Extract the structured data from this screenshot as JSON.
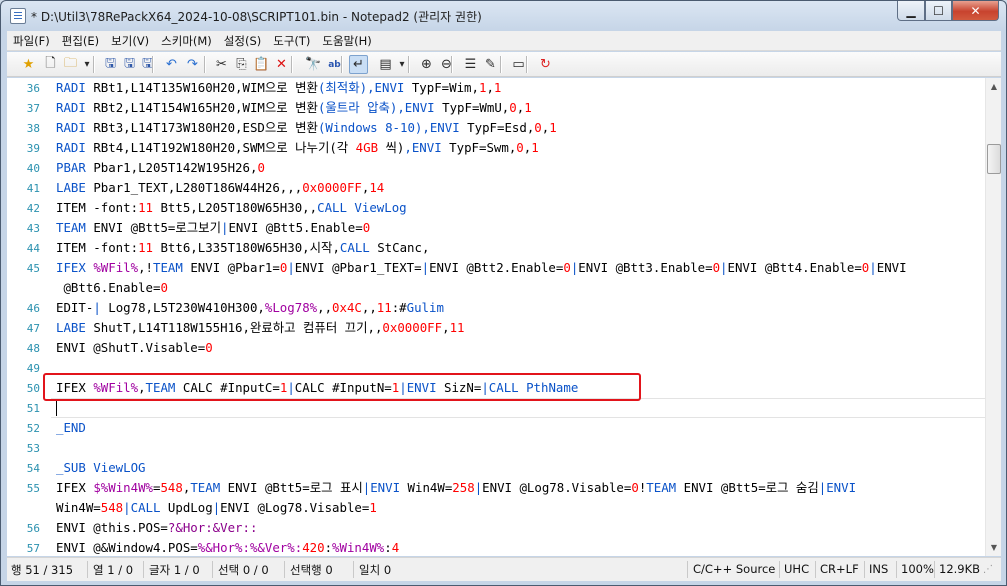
{
  "window": {
    "title": "* D:\\Util3\\78RePackX64_2024-10-08\\SCRIPT101.bin - Notepad2 (관리자 권한)",
    "controls": {
      "minimize": "▁",
      "maximize": "☐",
      "close": "✕"
    }
  },
  "menu": [
    "파일(F)",
    "편집(E)",
    "보기(V)",
    "스키마(M)",
    "설정(S)",
    "도구(T)",
    "도움말(H)"
  ],
  "toolbar": {
    "icons": [
      "star-icon",
      "new-file-icon",
      "open-folder-icon",
      "dropdown-icon",
      "save-icon",
      "save-as-icon",
      "save-copy-icon",
      "undo-icon",
      "redo-icon",
      "cut-icon",
      "copy-icon",
      "paste-icon",
      "delete-icon",
      "find-icon",
      "replace-icon",
      "word-wrap-icon",
      "scheme-icon",
      "dropdown-icon",
      "zoom-in-icon",
      "zoom-out-icon",
      "view-list-icon",
      "edit-icon",
      "terminal-icon",
      "exit-icon"
    ],
    "glyphs": [
      "★",
      "🗋",
      "🗀",
      "▾",
      "🖫",
      "🖫",
      "🖫",
      "↶",
      "↷",
      "✂",
      "⎘",
      "📋",
      "✕",
      "🔭",
      "ab",
      "↵",
      "▤",
      "▾",
      "⊕",
      "⊖",
      "☰",
      "✎",
      "▭",
      "↻"
    ]
  },
  "editor": {
    "lines": [
      {
        "num": "36",
        "tokens": [
          [
            "k",
            "RADI "
          ],
          [
            "d",
            "RBt1,L14T135W160H20,WIM으로 변환"
          ],
          [
            "k",
            "(최적화)"
          ],
          [
            "k",
            ",ENVI "
          ],
          [
            "d",
            "TypF=Wim,"
          ],
          [
            "n",
            "1"
          ],
          [
            "d",
            ","
          ],
          [
            "n",
            "1"
          ]
        ]
      },
      {
        "num": "37",
        "tokens": [
          [
            "k",
            "RADI "
          ],
          [
            "d",
            "RBt2,L14T154W165H20,WIM으로 변환"
          ],
          [
            "k",
            "(울트라 압축)"
          ],
          [
            "k",
            ",ENVI "
          ],
          [
            "d",
            "TypF=WmU,"
          ],
          [
            "n",
            "0"
          ],
          [
            "d",
            ","
          ],
          [
            "n",
            "1"
          ]
        ]
      },
      {
        "num": "38",
        "tokens": [
          [
            "k",
            "RADI "
          ],
          [
            "d",
            "RBt3,L14T173W180H20,ESD으로 변환"
          ],
          [
            "k",
            "(Windows 8-10)"
          ],
          [
            "k",
            ",ENVI "
          ],
          [
            "d",
            "TypF=Esd,"
          ],
          [
            "n",
            "0"
          ],
          [
            "d",
            ","
          ],
          [
            "n",
            "1"
          ]
        ]
      },
      {
        "num": "39",
        "tokens": [
          [
            "k",
            "RADI "
          ],
          [
            "d",
            "RBt4,L14T192W180H20,SWM으로 나누기(각 "
          ],
          [
            "n",
            "4GB"
          ],
          [
            "d",
            " 씩)"
          ],
          [
            "k",
            ",ENVI "
          ],
          [
            "d",
            "TypF=Swm,"
          ],
          [
            "n",
            "0"
          ],
          [
            "d",
            ","
          ],
          [
            "n",
            "1"
          ]
        ]
      },
      {
        "num": "40",
        "tokens": [
          [
            "k",
            "PBAR "
          ],
          [
            "d",
            "Pbar1,L205T142W195H26,"
          ],
          [
            "n",
            "0"
          ]
        ]
      },
      {
        "num": "41",
        "tokens": [
          [
            "k",
            "LABE "
          ],
          [
            "d",
            "Pbar1_TEXT,L280T186W44H26,,,"
          ],
          [
            "n",
            "0x0000FF"
          ],
          [
            "d",
            ","
          ],
          [
            "n",
            "14"
          ]
        ]
      },
      {
        "num": "42",
        "tokens": [
          [
            "d",
            "ITEM -font:"
          ],
          [
            "n",
            "11"
          ],
          [
            "d",
            " Btt5,L205T180W65H30,,"
          ],
          [
            "k",
            "CALL ViewLog"
          ]
        ]
      },
      {
        "num": "43",
        "tokens": [
          [
            "k",
            "TEAM "
          ],
          [
            "d",
            "ENVI @Btt5=로그보기"
          ],
          [
            "k",
            "|"
          ],
          [
            "d",
            "ENVI @Btt5.Enable="
          ],
          [
            "n",
            "0"
          ]
        ]
      },
      {
        "num": "44",
        "tokens": [
          [
            "d",
            "ITEM -font:"
          ],
          [
            "n",
            "11"
          ],
          [
            "d",
            " Btt6,L335T180W65H30,시작,"
          ],
          [
            "k",
            "CALL "
          ],
          [
            "d",
            "StCanc,"
          ]
        ]
      },
      {
        "num": "45",
        "tokens": [
          [
            "k",
            "IFEX "
          ],
          [
            "v",
            "%WFil%"
          ],
          [
            "d",
            ",!"
          ],
          [
            "k",
            "TEAM "
          ],
          [
            "d",
            "ENVI @Pbar1="
          ],
          [
            "n",
            "0"
          ],
          [
            "k",
            "|"
          ],
          [
            "d",
            "ENVI @Pbar1_TEXT="
          ],
          [
            "k",
            "|"
          ],
          [
            "d",
            "ENVI @Btt2.Enable="
          ],
          [
            "n",
            "0"
          ],
          [
            "k",
            "|"
          ],
          [
            "d",
            "ENVI @Btt3.Enable="
          ],
          [
            "n",
            "0"
          ],
          [
            "k",
            "|"
          ],
          [
            "d",
            "ENVI @Btt4.Enable="
          ],
          [
            "n",
            "0"
          ],
          [
            "k",
            "|"
          ],
          [
            "d",
            "ENVI"
          ]
        ]
      },
      {
        "num": "",
        "tokens": [
          [
            "d",
            " @Btt6.Enable="
          ],
          [
            "n",
            "0"
          ]
        ]
      },
      {
        "num": "46",
        "tokens": [
          [
            "d",
            "EDIT-"
          ],
          [
            "k",
            "| "
          ],
          [
            "d",
            "Log78,L5T230W410H300,"
          ],
          [
            "v",
            "%Log78%"
          ],
          [
            "d",
            ",,"
          ],
          [
            "n",
            "0x4C"
          ],
          [
            "d",
            ",,"
          ],
          [
            "n",
            "11"
          ],
          [
            "d",
            ":#"
          ],
          [
            "k",
            "Gulim"
          ]
        ]
      },
      {
        "num": "47",
        "tokens": [
          [
            "k",
            "LABE "
          ],
          [
            "d",
            "ShutT,L14T118W155H16,완료하고 컴퓨터 끄기,,"
          ],
          [
            "n",
            "0x0000FF"
          ],
          [
            "d",
            ","
          ],
          [
            "n",
            "11"
          ]
        ]
      },
      {
        "num": "48",
        "tokens": [
          [
            "d",
            "ENVI @ShutT.Visable="
          ],
          [
            "n",
            "0"
          ]
        ]
      },
      {
        "num": "49",
        "tokens": []
      },
      {
        "num": "50",
        "tokens": [
          [
            "d",
            "IFEX "
          ],
          [
            "v",
            "%WFil%"
          ],
          [
            "d",
            ","
          ],
          [
            "k",
            "TEAM "
          ],
          [
            "d",
            "CALC #InputC="
          ],
          [
            "n",
            "1"
          ],
          [
            "k",
            "|"
          ],
          [
            "d",
            "CALC #InputN="
          ],
          [
            "n",
            "1"
          ],
          [
            "k",
            "|ENVI "
          ],
          [
            "d",
            "SizN="
          ],
          [
            "k",
            "|CALL PthName"
          ]
        ]
      },
      {
        "num": "51",
        "tokens": []
      },
      {
        "num": "52",
        "tokens": [
          [
            "k",
            "_END"
          ]
        ]
      },
      {
        "num": "53",
        "tokens": []
      },
      {
        "num": "54",
        "tokens": [
          [
            "k",
            "_SUB ViewLOG"
          ]
        ]
      },
      {
        "num": "55",
        "tokens": [
          [
            "d",
            "IFEX "
          ],
          [
            "v",
            "$%Win4W%"
          ],
          [
            "d",
            "="
          ],
          [
            "n",
            "548"
          ],
          [
            "d",
            ","
          ],
          [
            "k",
            "TEAM "
          ],
          [
            "d",
            "ENVI @Btt5=로그 표시"
          ],
          [
            "k",
            "|ENVI "
          ],
          [
            "d",
            "Win4W="
          ],
          [
            "n",
            "258"
          ],
          [
            "k",
            "|"
          ],
          [
            "d",
            "ENVI @Log78.Visable="
          ],
          [
            "n",
            "0"
          ],
          [
            "d",
            "!"
          ],
          [
            "k",
            "TEAM "
          ],
          [
            "d",
            "ENVI @Btt5=로그 숨김"
          ],
          [
            "k",
            "|ENVI"
          ]
        ]
      },
      {
        "num": "",
        "tokens": [
          [
            "d",
            "Win4W="
          ],
          [
            "n",
            "548"
          ],
          [
            "k",
            "|CALL "
          ],
          [
            "d",
            "UpdLog"
          ],
          [
            "k",
            "|"
          ],
          [
            "d",
            "ENVI @Log78.Visable="
          ],
          [
            "n",
            "1"
          ]
        ]
      },
      {
        "num": "56",
        "tokens": [
          [
            "d",
            "ENVI @this.POS="
          ],
          [
            "c",
            "?&Hor:&Ver::"
          ]
        ]
      },
      {
        "num": "57",
        "tokens": [
          [
            "d",
            "ENVI @&Window4.POS="
          ],
          [
            "v",
            "%&Hor%:%&Ver%:"
          ],
          [
            "n",
            "420"
          ],
          [
            "d",
            ":"
          ],
          [
            "v",
            "%Win4W%"
          ],
          [
            "d",
            ":"
          ],
          [
            "n",
            "4"
          ]
        ]
      }
    ]
  },
  "status": {
    "line": "행 51 / 315",
    "col": "열 1 / 0",
    "char": "글자 1 / 0",
    "sel": "선택 0 / 0",
    "selline": "선택행 0",
    "match": "일치 0",
    "scheme": "C/C++ Source",
    "encoding": "UHC",
    "eol": "CR+LF",
    "ovr": "INS",
    "zoom": "100%",
    "size": "12.9KB"
  }
}
